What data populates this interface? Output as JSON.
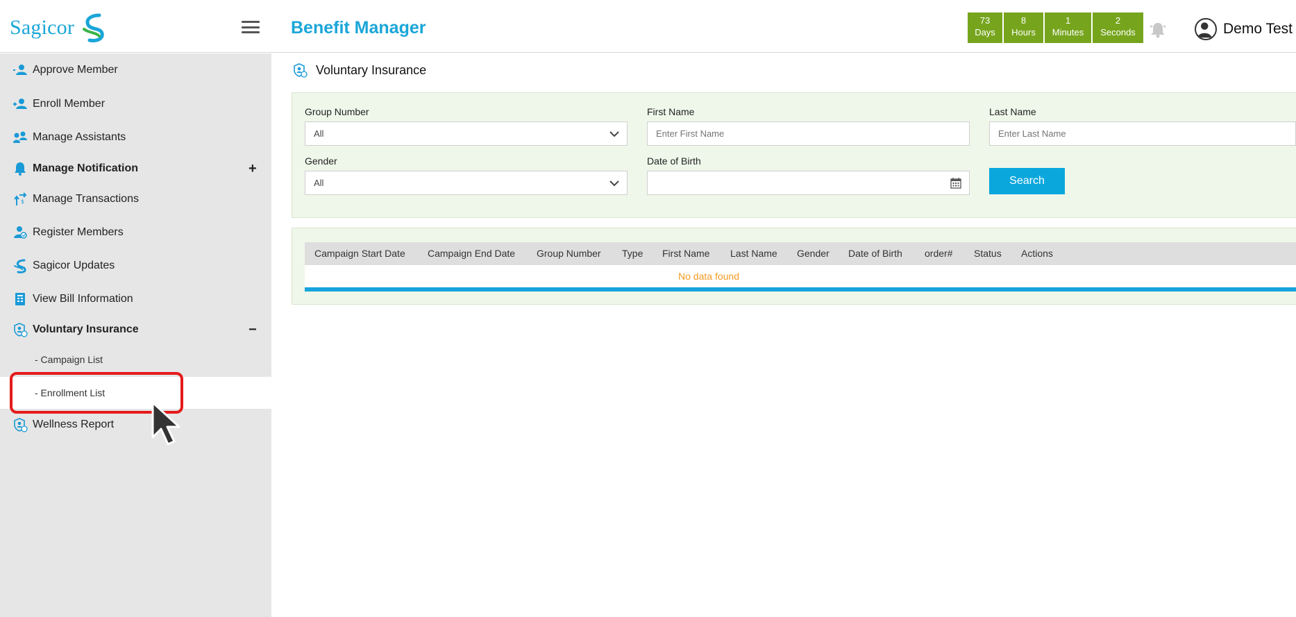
{
  "header": {
    "logo_text": "Sagicor",
    "app_title": "Benefit Manager",
    "timer": [
      {
        "value": "73",
        "unit": "Days"
      },
      {
        "value": "8",
        "unit": "Hours"
      },
      {
        "value": "1",
        "unit": "Minutes"
      },
      {
        "value": "2",
        "unit": "Seconds"
      }
    ],
    "user_name": "Demo Test"
  },
  "sidebar": {
    "items": [
      {
        "label": "Approve Member",
        "icon": "user-check-icon"
      },
      {
        "label": "Enroll Member",
        "icon": "user-plus-icon"
      },
      {
        "label": "Manage Assistants",
        "icon": "users-icon"
      },
      {
        "label": "Manage Notification",
        "icon": "bell-icon",
        "toggle": "+"
      },
      {
        "label": "Manage Transactions",
        "icon": "transactions-icon"
      },
      {
        "label": "Register Members",
        "icon": "register-user-icon"
      },
      {
        "label": "Sagicor Updates",
        "icon": "sagicor-logo-icon"
      },
      {
        "label": "View Bill Information",
        "icon": "bill-icon"
      },
      {
        "label": "Voluntary Insurance",
        "icon": "shield-person-icon",
        "toggle": "−"
      },
      {
        "label": "Wellness Report",
        "icon": "shield-person-icon"
      }
    ],
    "subitems": [
      {
        "label": "- Campaign List"
      },
      {
        "label": "- Enrollment List"
      }
    ]
  },
  "page": {
    "title": "Voluntary Insurance"
  },
  "filters": {
    "group_number_label": "Group Number",
    "group_number_value": "All",
    "first_name_label": "First Name",
    "first_name_placeholder": "Enter First Name",
    "last_name_label": "Last Name",
    "last_name_placeholder": "Enter Last Name",
    "gender_label": "Gender",
    "gender_value": "All",
    "dob_label": "Date of Birth",
    "search_label": "Search"
  },
  "table": {
    "columns": [
      "Campaign Start Date",
      "Campaign End Date",
      "Group Number",
      "Type",
      "First Name",
      "Last Name",
      "Gender",
      "Date of Birth",
      "order#",
      "Status",
      "Actions"
    ],
    "empty_message": "No data found"
  },
  "colors": {
    "brand_blue": "#1aa6d9",
    "timer_green": "#76a51d",
    "panel_green": "#eff7ea",
    "highlight_red": "#e41b1b",
    "empty_orange": "#f39a1f"
  }
}
